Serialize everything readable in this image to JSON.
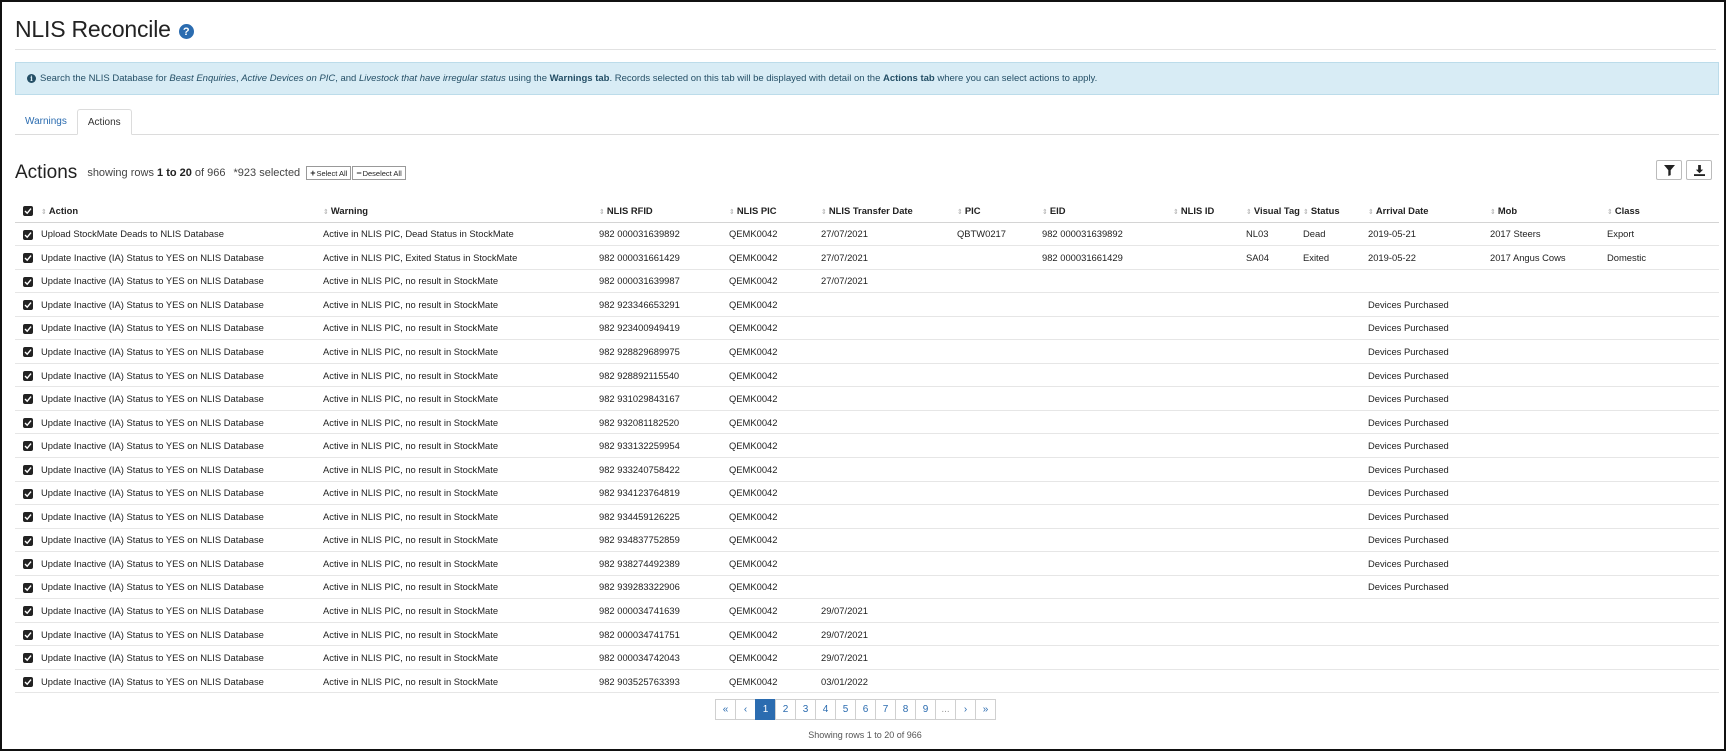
{
  "header": {
    "title": "NLIS Reconcile",
    "help_label": "?"
  },
  "banner": {
    "p1": "Search the NLIS Database for ",
    "e1": "Beast Enquiries",
    "p2": ", ",
    "e2": "Active Devices on PIC",
    "p3": ", and ",
    "e3": "Livestock that have irregular status",
    "p4": " using the ",
    "b1": "Warnings tab",
    "p5": ". Records selected on this tab will be displayed with detail on the ",
    "b2": "Actions tab",
    "p6": " where you can select actions to apply."
  },
  "tabs": [
    {
      "label": "Warnings"
    },
    {
      "label": "Actions"
    }
  ],
  "section": {
    "title": "Actions",
    "showing_prefix": "showing rows ",
    "showing_range": "1 to 20",
    "showing_of": " of 966",
    "selected": "*923 selected",
    "select_all": "Select All",
    "deselect_all": "Deselect All"
  },
  "columns": [
    "Action",
    "Warning",
    "NLIS RFID",
    "NLIS PIC",
    "NLIS Transfer Date",
    "PIC",
    "EID",
    "NLIS ID",
    "Visual Tag",
    "Status",
    "Arrival Date",
    "Mob",
    "Class"
  ],
  "rows": [
    [
      "Upload StockMate Deads to NLIS Database",
      "Active in NLIS PIC, Dead Status in StockMate",
      "982 000031639892",
      "QEMK0042",
      "27/07/2021",
      "QBTW0217",
      "982 000031639892",
      "",
      "NL03",
      "Dead",
      "2019-05-21",
      "2017 Steers",
      "Export"
    ],
    [
      "Update Inactive (IA) Status to YES on NLIS Database",
      "Active in NLIS PIC, Exited Status in StockMate",
      "982 000031661429",
      "QEMK0042",
      "27/07/2021",
      "",
      "982 000031661429",
      "",
      "SA04",
      "Exited",
      "2019-05-22",
      "2017 Angus Cows",
      "Domestic"
    ],
    [
      "Update Inactive (IA) Status to YES on NLIS Database",
      "Active in NLIS PIC, no result in StockMate",
      "982 000031639987",
      "QEMK0042",
      "27/07/2021",
      "",
      "",
      "",
      "",
      "",
      "",
      "",
      ""
    ],
    [
      "Update Inactive (IA) Status to YES on NLIS Database",
      "Active in NLIS PIC, no result in StockMate",
      "982 923346653291",
      "QEMK0042",
      "",
      "",
      "",
      "",
      "",
      "",
      "Devices Purchased",
      "",
      ""
    ],
    [
      "Update Inactive (IA) Status to YES on NLIS Database",
      "Active in NLIS PIC, no result in StockMate",
      "982 923400949419",
      "QEMK0042",
      "",
      "",
      "",
      "",
      "",
      "",
      "Devices Purchased",
      "",
      ""
    ],
    [
      "Update Inactive (IA) Status to YES on NLIS Database",
      "Active in NLIS PIC, no result in StockMate",
      "982 928829689975",
      "QEMK0042",
      "",
      "",
      "",
      "",
      "",
      "",
      "Devices Purchased",
      "",
      ""
    ],
    [
      "Update Inactive (IA) Status to YES on NLIS Database",
      "Active in NLIS PIC, no result in StockMate",
      "982 928892115540",
      "QEMK0042",
      "",
      "",
      "",
      "",
      "",
      "",
      "Devices Purchased",
      "",
      ""
    ],
    [
      "Update Inactive (IA) Status to YES on NLIS Database",
      "Active in NLIS PIC, no result in StockMate",
      "982 931029843167",
      "QEMK0042",
      "",
      "",
      "",
      "",
      "",
      "",
      "Devices Purchased",
      "",
      ""
    ],
    [
      "Update Inactive (IA) Status to YES on NLIS Database",
      "Active in NLIS PIC, no result in StockMate",
      "982 932081182520",
      "QEMK0042",
      "",
      "",
      "",
      "",
      "",
      "",
      "Devices Purchased",
      "",
      ""
    ],
    [
      "Update Inactive (IA) Status to YES on NLIS Database",
      "Active in NLIS PIC, no result in StockMate",
      "982 933132259954",
      "QEMK0042",
      "",
      "",
      "",
      "",
      "",
      "",
      "Devices Purchased",
      "",
      ""
    ],
    [
      "Update Inactive (IA) Status to YES on NLIS Database",
      "Active in NLIS PIC, no result in StockMate",
      "982 933240758422",
      "QEMK0042",
      "",
      "",
      "",
      "",
      "",
      "",
      "Devices Purchased",
      "",
      ""
    ],
    [
      "Update Inactive (IA) Status to YES on NLIS Database",
      "Active in NLIS PIC, no result in StockMate",
      "982 934123764819",
      "QEMK0042",
      "",
      "",
      "",
      "",
      "",
      "",
      "Devices Purchased",
      "",
      ""
    ],
    [
      "Update Inactive (IA) Status to YES on NLIS Database",
      "Active in NLIS PIC, no result in StockMate",
      "982 934459126225",
      "QEMK0042",
      "",
      "",
      "",
      "",
      "",
      "",
      "Devices Purchased",
      "",
      ""
    ],
    [
      "Update Inactive (IA) Status to YES on NLIS Database",
      "Active in NLIS PIC, no result in StockMate",
      "982 934837752859",
      "QEMK0042",
      "",
      "",
      "",
      "",
      "",
      "",
      "Devices Purchased",
      "",
      ""
    ],
    [
      "Update Inactive (IA) Status to YES on NLIS Database",
      "Active in NLIS PIC, no result in StockMate",
      "982 938274492389",
      "QEMK0042",
      "",
      "",
      "",
      "",
      "",
      "",
      "Devices Purchased",
      "",
      ""
    ],
    [
      "Update Inactive (IA) Status to YES on NLIS Database",
      "Active in NLIS PIC, no result in StockMate",
      "982 939283322906",
      "QEMK0042",
      "",
      "",
      "",
      "",
      "",
      "",
      "Devices Purchased",
      "",
      ""
    ],
    [
      "Update Inactive (IA) Status to YES on NLIS Database",
      "Active in NLIS PIC, no result in StockMate",
      "982 000034741639",
      "QEMK0042",
      "29/07/2021",
      "",
      "",
      "",
      "",
      "",
      "",
      "",
      ""
    ],
    [
      "Update Inactive (IA) Status to YES on NLIS Database",
      "Active in NLIS PIC, no result in StockMate",
      "982 000034741751",
      "QEMK0042",
      "29/07/2021",
      "",
      "",
      "",
      "",
      "",
      "",
      "",
      ""
    ],
    [
      "Update Inactive (IA) Status to YES on NLIS Database",
      "Active in NLIS PIC, no result in StockMate",
      "982 000034742043",
      "QEMK0042",
      "29/07/2021",
      "",
      "",
      "",
      "",
      "",
      "",
      "",
      ""
    ],
    [
      "Update Inactive (IA) Status to YES on NLIS Database",
      "Active in NLIS PIC, no result in StockMate",
      "982 903525763393",
      "QEMK0042",
      "03/01/2022",
      "",
      "",
      "",
      "",
      "",
      "",
      "",
      ""
    ]
  ],
  "pagination": {
    "first": "«",
    "prev": "‹",
    "pages": [
      "1",
      "2",
      "3",
      "4",
      "5",
      "6",
      "7",
      "8",
      "9"
    ],
    "ellipsis": "...",
    "next": "›",
    "last": "»",
    "active_page": "1",
    "footer_prefix": "Showing rows ",
    "footer_range": "1 to 20",
    "footer_of": " of 966"
  },
  "colors": {
    "accent": "#2b6cb0",
    "banner_bg": "#d8ecf5",
    "banner_text": "#244f66"
  },
  "icons": {
    "help": "question-circle-icon",
    "info": "info-circle-icon",
    "filter": "filter-icon",
    "download": "download-icon",
    "checkbox": "checkbox-checked-icon"
  }
}
